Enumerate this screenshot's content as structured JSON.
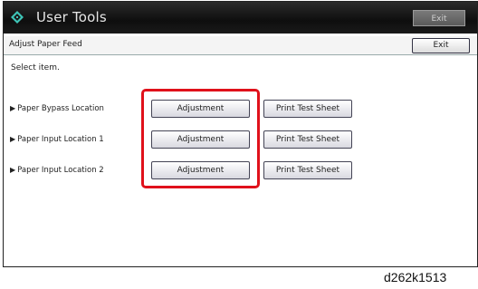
{
  "header": {
    "app_title": "User Tools",
    "exit_label": "Exit"
  },
  "subheader": {
    "title": "Adjust Paper Feed",
    "exit_label": "Exit"
  },
  "instruction": "Select item.",
  "rows": [
    {
      "label": "Paper Bypass Location",
      "adjust_label": "Adjustment",
      "print_label": "Print Test Sheet"
    },
    {
      "label": "Paper Input Location 1",
      "adjust_label": "Adjustment",
      "print_label": "Print Test Sheet"
    },
    {
      "label": "Paper Input Location 2",
      "adjust_label": "Adjustment",
      "print_label": "Print Test Sheet"
    }
  ],
  "caption": "d262k1513",
  "colors": {
    "titlebar": "#111111",
    "highlight": "#e0111b",
    "icon": "#3ec6b8"
  },
  "icons": {
    "title_icon": "diamond-grid-icon",
    "row_marker": "triangle-right-icon"
  }
}
